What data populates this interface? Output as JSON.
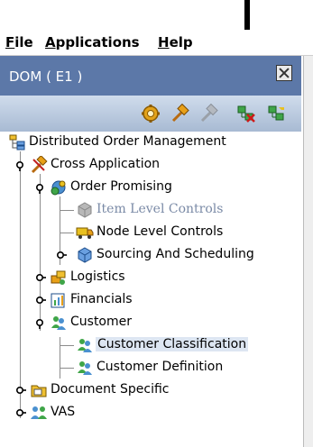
{
  "menu": {
    "file": "File",
    "applications": "Applications",
    "help": "Help"
  },
  "panel": {
    "title": "DOM ( E1 )"
  },
  "toolbar": {
    "icons": [
      "gear-icon",
      "hammer-icon",
      "disabled-hammer-icon",
      "delete-node-icon",
      "add-node-icon"
    ]
  },
  "tree": {
    "root": "Distributed Order Management",
    "cross_application": "Cross Application",
    "order_promising": "Order Promising",
    "item_level_controls": "Item Level Controls",
    "node_level_controls": "Node Level Controls",
    "sourcing_and_scheduling": "Sourcing And Scheduling",
    "logistics": "Logistics",
    "financials": "Financials",
    "customer": "Customer",
    "customer_classification": "Customer Classification",
    "customer_definition": "Customer Definition",
    "document_specific": "Document Specific",
    "vas": "VAS"
  }
}
